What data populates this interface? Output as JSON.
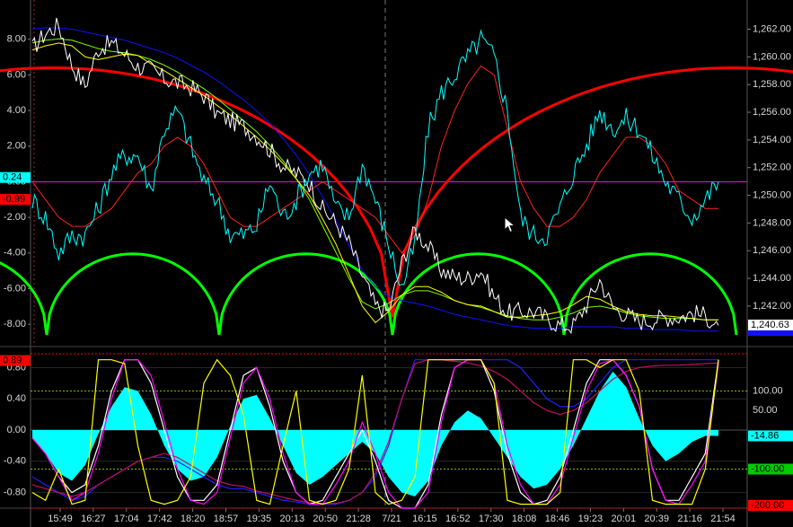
{
  "chart_data": [
    {
      "type": "line",
      "panel": "upper",
      "left_axis": {
        "ticks": [
          "8.00",
          "6.00",
          "4.00",
          "2.00",
          "0.00",
          "-2.00",
          "-4.00",
          "-6.00",
          "-8.00"
        ],
        "ylim": [
          -9.0,
          9.5
        ]
      },
      "right_axis": {
        "ticks": [
          "1,262.00",
          "1,260.00",
          "1,258.00",
          "1,256.00",
          "1,254.00",
          "1,252.00",
          "1,250.00",
          "1,248.00",
          "1,246.00",
          "1,244.00",
          "1,242.00"
        ],
        "ylim": [
          1239.4,
          1263.2
        ]
      },
      "markers": [
        {
          "text": "0.24",
          "value": 0.24,
          "axis": "left",
          "color": "#00ffff"
        },
        {
          "text": "-0.99",
          "value": -0.99,
          "axis": "left",
          "color": "#ff0000"
        },
        {
          "text": "1,240.63",
          "value": 1240.63,
          "axis": "right",
          "color": "#ffffff"
        }
      ],
      "hline": {
        "value": 0.0,
        "color": "#ff00ff"
      },
      "series": [
        {
          "color": "#ffffff",
          "axis": "right",
          "values": [
            1260.6,
            1261.7,
            1262.3,
            1259.4,
            1257.9,
            1260.6,
            1261.0,
            1260.2,
            1259.3,
            1259.1,
            1258.4,
            1258.1,
            1257.8,
            1257.2,
            1255.9,
            1255.4,
            1255.0,
            1254.3,
            1253.3,
            1252.1,
            1251.6,
            1250.9,
            1249.0,
            1248.0,
            1246.6,
            1244.2,
            1242.0,
            1241.6,
            1245.1,
            1247.5,
            1246.3,
            1244.6,
            1244.1,
            1244.0,
            1244.6,
            1242.7,
            1241.5,
            1241.6,
            1241.6,
            1241.1,
            1240.6,
            1240.6,
            1242.1,
            1243.9,
            1241.9,
            1241.4,
            1240.9,
            1241.0,
            1241.2,
            1241.2,
            1241.5,
            1241.3,
            1240.6
          ]
        },
        {
          "color": "#00ffff",
          "axis": "left",
          "values": [
            -1.0,
            -2.0,
            -4.0,
            -3.0,
            -3.0,
            -1.5,
            0.5,
            1.5,
            1.5,
            -0.5,
            3.0,
            4.0,
            2.0,
            0.0,
            -1.0,
            -3.0,
            -3.0,
            -2.5,
            0.0,
            -2.0,
            -1.0,
            0.5,
            1.0,
            -1.5,
            -2.0,
            1.0,
            -1.0,
            -3.5,
            -6.0,
            -3.5,
            3.0,
            5.0,
            6.0,
            7.0,
            8.0,
            7.0,
            4.0,
            -2.0,
            -3.0,
            -3.0,
            -1.5,
            0.5,
            2.0,
            4.0,
            3.0,
            3.5,
            3.0,
            1.5,
            0.0,
            -1.0,
            -2.0,
            -1.0,
            0.0
          ]
        },
        {
          "color": "#ff2020",
          "axis": "left",
          "values": [
            0.0,
            -1.0,
            -2.0,
            -2.5,
            -2.5,
            -2.0,
            -1.5,
            -0.5,
            0.5,
            1.0,
            2.0,
            2.5,
            2.0,
            1.0,
            -0.5,
            -2.0,
            -2.5,
            -2.5,
            -2.0,
            -1.5,
            -1.0,
            -0.5,
            0.0,
            -0.5,
            -1.0,
            -1.5,
            -2.0,
            -3.0,
            -4.0,
            -3.0,
            -1.0,
            2.0,
            4.0,
            5.5,
            6.5,
            6.0,
            3.0,
            0.0,
            -1.5,
            -2.5,
            -2.5,
            -2.0,
            -1.0,
            0.5,
            1.5,
            2.5,
            2.5,
            2.0,
            1.0,
            -0.5,
            -1.0,
            -1.5,
            -1.5
          ]
        },
        {
          "color": "#ffff00",
          "axis": "right",
          "values": [
            1260.5,
            1260.8,
            1261.0,
            1260.8,
            1260.0,
            1259.8,
            1260.0,
            1260.2,
            1260.1,
            1259.5,
            1259.0,
            1258.4,
            1257.8,
            1257.2,
            1256.5,
            1255.8,
            1255.0,
            1254.2,
            1253.3,
            1252.3,
            1251.2,
            1250.0,
            1248.3,
            1246.5,
            1244.3,
            1242.0,
            1240.8,
            1241.6,
            1242.8,
            1243.4,
            1243.4,
            1243.0,
            1242.4,
            1242.1,
            1242.0,
            1241.6,
            1241.2,
            1241.2,
            1241.3,
            1241.4,
            1241.6,
            1242.1,
            1242.7,
            1242.5,
            1242.0,
            1241.6,
            1241.4,
            1241.3,
            1241.3,
            1241.2,
            1241.1,
            1241.0,
            1241.0
          ]
        },
        {
          "color": "#7fff00",
          "axis": "right",
          "values": [
            1261.0,
            1261.2,
            1261.3,
            1261.2,
            1260.9,
            1260.6,
            1260.4,
            1260.3,
            1260.1,
            1259.8,
            1259.4,
            1258.9,
            1258.3,
            1257.7,
            1257.0,
            1256.2,
            1255.4,
            1254.6,
            1253.6,
            1252.5,
            1251.2,
            1249.7,
            1247.8,
            1245.9,
            1244.0,
            1242.3,
            1241.8,
            1242.2,
            1242.8,
            1243.1,
            1243.1,
            1242.8,
            1242.4,
            1242.1,
            1241.9,
            1241.6,
            1241.3,
            1241.1,
            1241.0,
            1241.0,
            1241.2,
            1241.5,
            1241.9,
            1242.0,
            1241.8,
            1241.5,
            1241.3,
            1241.2,
            1241.1,
            1241.1,
            1241.1,
            1241.0,
            1241.0
          ]
        },
        {
          "color": "#1010ff",
          "axis": "right",
          "values": [
            1262.0,
            1262.1,
            1262.1,
            1262.0,
            1261.8,
            1261.6,
            1261.4,
            1261.2,
            1260.9,
            1260.6,
            1260.3,
            1259.9,
            1259.4,
            1258.9,
            1258.3,
            1257.6,
            1256.9,
            1256.1,
            1255.2,
            1254.1,
            1252.9,
            1251.5,
            1249.9,
            1248.2,
            1246.4,
            1244.6,
            1243.4,
            1242.7,
            1242.4,
            1242.2,
            1242.0,
            1241.7,
            1241.4,
            1241.2,
            1241.0,
            1240.8,
            1240.6,
            1240.5,
            1240.4,
            1240.4,
            1240.4,
            1240.5,
            1240.5,
            1240.5,
            1240.5,
            1240.4,
            1240.4,
            1240.3,
            1240.3,
            1240.3,
            1240.2,
            1240.2,
            1240.2
          ]
        }
      ],
      "cycle_arcs": [
        {
          "color": "#ff0000",
          "scale": "big"
        },
        {
          "color": "#00ff00",
          "scale": "small"
        }
      ]
    },
    {
      "type": "area",
      "panel": "lower",
      "left_axis": {
        "ticks": [
          "0.80",
          "0.40",
          "0.00",
          "-0.40",
          "-0.80"
        ],
        "ylim": [
          -1.0,
          1.0
        ]
      },
      "right_axis": {
        "ticks": [
          "100.00",
          "50.00"
        ],
        "ylim": [
          -200,
          200
        ]
      },
      "markers": [
        {
          "text": "0.89",
          "value": 0.89,
          "axis": "left",
          "color": "#ff0000"
        },
        {
          "text": "-14.86",
          "value": -14.86,
          "axis": "right",
          "color": "#00ffff"
        },
        {
          "text": "-100.00",
          "value": -100.0,
          "axis": "right",
          "color": "#00cc00"
        },
        {
          "text": "-200.00",
          "value": -200.0,
          "axis": "right",
          "color": "#ff0000"
        }
      ],
      "hlines": [
        {
          "value": 100,
          "axis": "right",
          "color": "#7fbf00"
        },
        {
          "value": -100,
          "axis": "right",
          "color": "#7fbf00"
        },
        {
          "value": -200,
          "axis": "right",
          "color": "#ff0000"
        }
      ],
      "histogram": {
        "color": "#00ffff",
        "axis": "right",
        "values": [
          -20,
          -60,
          -110,
          -130,
          -90,
          -10,
          60,
          110,
          100,
          40,
          -40,
          -100,
          -130,
          -120,
          -70,
          10,
          80,
          90,
          30,
          -40,
          -110,
          -140,
          -120,
          -90,
          -60,
          -30,
          -60,
          -120,
          -160,
          -170,
          -130,
          -40,
          20,
          50,
          30,
          -20,
          -70,
          -120,
          -150,
          -140,
          -100,
          -40,
          30,
          100,
          150,
          110,
          30,
          -40,
          -80,
          -60,
          -30,
          -15,
          -14.86
        ]
      },
      "series": [
        {
          "color": "#ffffff",
          "axis": "left",
          "values": [
            -0.1,
            -0.3,
            -0.6,
            -0.8,
            -0.7,
            -0.2,
            0.5,
            0.9,
            0.9,
            0.6,
            0.0,
            -0.6,
            -0.9,
            -0.9,
            -0.7,
            0.0,
            0.7,
            0.8,
            0.3,
            -0.4,
            -0.8,
            -0.95,
            -0.9,
            -0.6,
            -0.3,
            0.0,
            -0.4,
            -0.9,
            -1.0,
            -1.0,
            -0.7,
            0.2,
            0.8,
            0.9,
            0.9,
            0.5,
            -0.3,
            -0.8,
            -0.95,
            -0.9,
            -0.6,
            0.0,
            0.6,
            0.9,
            0.9,
            0.7,
            0.3,
            -0.5,
            -0.9,
            -0.9,
            -0.6,
            -0.3,
            0.9
          ]
        },
        {
          "color": "#ff00ff",
          "axis": "left",
          "values": [
            -0.1,
            -0.3,
            -0.6,
            -0.9,
            -0.8,
            -0.3,
            0.4,
            0.9,
            0.9,
            0.7,
            0.1,
            -0.5,
            -0.9,
            -0.95,
            -0.8,
            -0.1,
            0.6,
            0.8,
            0.4,
            -0.3,
            -0.8,
            -0.95,
            -0.95,
            -0.7,
            -0.4,
            0.1,
            -0.3,
            -0.8,
            -1.0,
            -1.0,
            -0.8,
            0.1,
            0.8,
            0.9,
            0.9,
            0.6,
            -0.2,
            -0.7,
            -0.95,
            -0.95,
            -0.7,
            -0.1,
            0.5,
            0.85,
            0.9,
            0.7,
            0.3,
            -0.5,
            -0.9,
            -0.95,
            -0.7,
            -0.4,
            0.85
          ]
        },
        {
          "color": "#ffff00",
          "axis": "left",
          "values": [
            -0.8,
            -0.9,
            -0.5,
            -0.95,
            -0.9,
            0.9,
            0.9,
            0.85,
            -0.2,
            -0.9,
            -0.95,
            -0.9,
            -0.6,
            0.6,
            0.9,
            0.7,
            0.2,
            -0.9,
            -0.95,
            -0.2,
            0.5,
            -0.9,
            -0.95,
            -0.9,
            -0.5,
            0.7,
            -0.8,
            -0.95,
            -0.9,
            -0.6,
            0.9,
            0.9,
            0.9,
            0.9,
            0.9,
            0.6,
            -0.9,
            -0.95,
            -0.95,
            -0.95,
            -0.8,
            0.9,
            0.9,
            0.8,
            0.9,
            0.9,
            0.5,
            -0.9,
            -0.95,
            -0.95,
            -0.95,
            -0.5,
            0.9
          ]
        },
        {
          "color": "#2020ff",
          "axis": "left",
          "values": [
            -0.6,
            -0.7,
            -0.8,
            -0.9,
            -0.85,
            -0.7,
            -0.6,
            -0.5,
            -0.4,
            -0.35,
            -0.35,
            -0.4,
            -0.5,
            -0.6,
            -0.7,
            -0.75,
            -0.75,
            -0.8,
            -0.85,
            -0.9,
            -0.92,
            -0.95,
            -0.95,
            -0.95,
            -0.9,
            -0.8,
            -0.6,
            -0.2,
            0.4,
            0.9,
            0.9,
            0.9,
            0.9,
            0.9,
            0.9,
            0.9,
            0.9,
            0.8,
            0.6,
            0.4,
            0.3,
            0.3,
            0.4,
            0.6,
            0.8,
            0.9,
            0.9,
            0.9,
            0.9,
            0.9,
            0.9,
            0.9,
            0.9
          ]
        },
        {
          "color": "#c01060",
          "axis": "left",
          "values": [
            -0.7,
            -0.75,
            -0.8,
            -0.85,
            -0.8,
            -0.7,
            -0.6,
            -0.5,
            -0.4,
            -0.35,
            -0.3,
            -0.35,
            -0.45,
            -0.55,
            -0.65,
            -0.7,
            -0.72,
            -0.78,
            -0.82,
            -0.86,
            -0.9,
            -0.93,
            -0.94,
            -0.94,
            -0.9,
            -0.8,
            -0.55,
            -0.15,
            0.4,
            0.85,
            0.9,
            0.9,
            0.88,
            0.86,
            0.82,
            0.75,
            0.65,
            0.5,
            0.35,
            0.25,
            0.2,
            0.25,
            0.35,
            0.5,
            0.65,
            0.75,
            0.8,
            0.82,
            0.83,
            0.83,
            0.84,
            0.85,
            0.86
          ]
        }
      ]
    }
  ],
  "x_axis": {
    "ticks": [
      "15:49",
      "16:27",
      "17:04",
      "17:42",
      "18:20",
      "18:57",
      "19:35",
      "20:13",
      "20:50",
      "21:28",
      "7/21",
      "16:15",
      "16:52",
      "17:30",
      "18:08",
      "18:46",
      "19:23",
      "20:01",
      "20:39",
      "21:16",
      "21:54"
    ],
    "session_break_index": 10
  }
}
